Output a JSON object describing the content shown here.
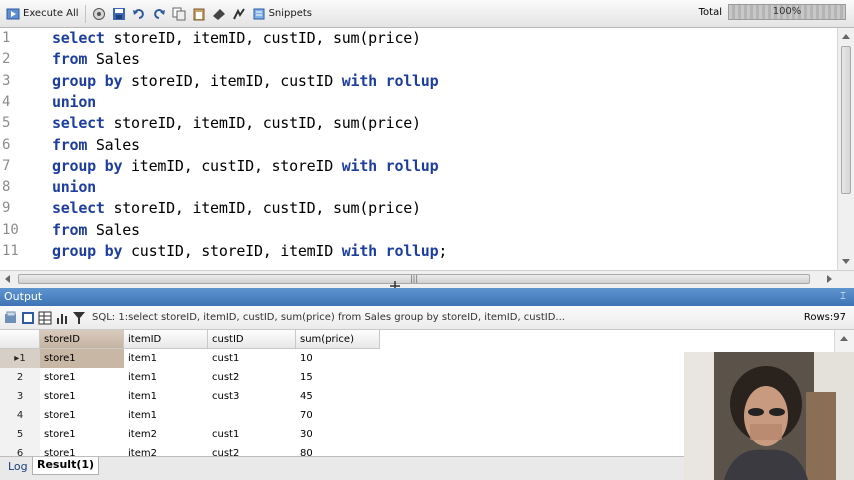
{
  "toolbar": {
    "execute_all_label": "Execute All",
    "snippets_label": "Snippets",
    "total_label": "Total",
    "total_progress_text": "100%",
    "total_progress": 1.0,
    "icons": [
      "execute-icon",
      "open-icon",
      "save-icon",
      "undo-icon",
      "redo-icon",
      "copy-icon",
      "paste-icon",
      "format-icon",
      "comment-icon",
      "snippets-icon"
    ]
  },
  "editor": {
    "lines": [
      {
        "num": "1",
        "tokens": [
          {
            "t": "select",
            "k": true
          },
          {
            "t": " storeID, itemID, custID, sum(price)",
            "k": false
          }
        ]
      },
      {
        "num": "2",
        "tokens": [
          {
            "t": "from",
            "k": true
          },
          {
            "t": " Sales",
            "k": false
          }
        ]
      },
      {
        "num": "3",
        "tokens": [
          {
            "t": "group by",
            "k": true
          },
          {
            "t": " storeID, itemID, custID ",
            "k": false
          },
          {
            "t": "with rollup",
            "k": true
          }
        ]
      },
      {
        "num": "4",
        "tokens": [
          {
            "t": "union",
            "k": true
          }
        ]
      },
      {
        "num": "5",
        "tokens": [
          {
            "t": "select",
            "k": true
          },
          {
            "t": " storeID, itemID, custID, sum(price)",
            "k": false
          }
        ]
      },
      {
        "num": "6",
        "tokens": [
          {
            "t": "from",
            "k": true
          },
          {
            "t": " Sales",
            "k": false
          }
        ]
      },
      {
        "num": "7",
        "tokens": [
          {
            "t": "group by",
            "k": true
          },
          {
            "t": " itemID, custID, storeID ",
            "k": false
          },
          {
            "t": "with rollup",
            "k": true
          }
        ]
      },
      {
        "num": "8",
        "tokens": [
          {
            "t": "union",
            "k": true
          }
        ]
      },
      {
        "num": "9",
        "tokens": [
          {
            "t": "select",
            "k": true
          },
          {
            "t": " storeID, itemID, custID, sum(price)",
            "k": false
          }
        ]
      },
      {
        "num": "10",
        "tokens": [
          {
            "t": "from",
            "k": true
          },
          {
            "t": " Sales",
            "k": false
          }
        ]
      },
      {
        "num": "11",
        "tokens": [
          {
            "t": "group by",
            "k": true
          },
          {
            "t": " custID, storeID, itemID ",
            "k": false
          },
          {
            "t": "with rollup",
            "k": true
          },
          {
            "t": ";",
            "k": false
          }
        ]
      }
    ]
  },
  "output": {
    "title": "Output",
    "pin_glyph": "⌶",
    "sql_summary": "SQL: 1:select storeID, itemID, custID, sum(price)  from Sales  group by storeID, itemID, custID...",
    "rows_label": "Rows:97",
    "columns": [
      "storeID",
      "itemID",
      "custID",
      "sum(price)"
    ],
    "rows": [
      {
        "n": "1",
        "storeID": "store1",
        "itemID": "item1",
        "custID": "cust1",
        "sum": "10"
      },
      {
        "n": "2",
        "storeID": "store1",
        "itemID": "item1",
        "custID": "cust2",
        "sum": "15"
      },
      {
        "n": "3",
        "storeID": "store1",
        "itemID": "item1",
        "custID": "cust3",
        "sum": "45"
      },
      {
        "n": "4",
        "storeID": "store1",
        "itemID": "item1",
        "custID": "",
        "sum": "70"
      },
      {
        "n": "5",
        "storeID": "store1",
        "itemID": "item2",
        "custID": "cust1",
        "sum": "30"
      },
      {
        "n": "6",
        "storeID": "store1",
        "itemID": "item2",
        "custID": "cust2",
        "sum": "80"
      }
    ],
    "tabs": [
      "Log",
      "Result(1)"
    ],
    "active_tab": "Result(1)"
  },
  "colors": {
    "keyword": "#1d3e9e",
    "panel_title": "#4a80c0",
    "selected_cell": "#c9b7a6"
  }
}
